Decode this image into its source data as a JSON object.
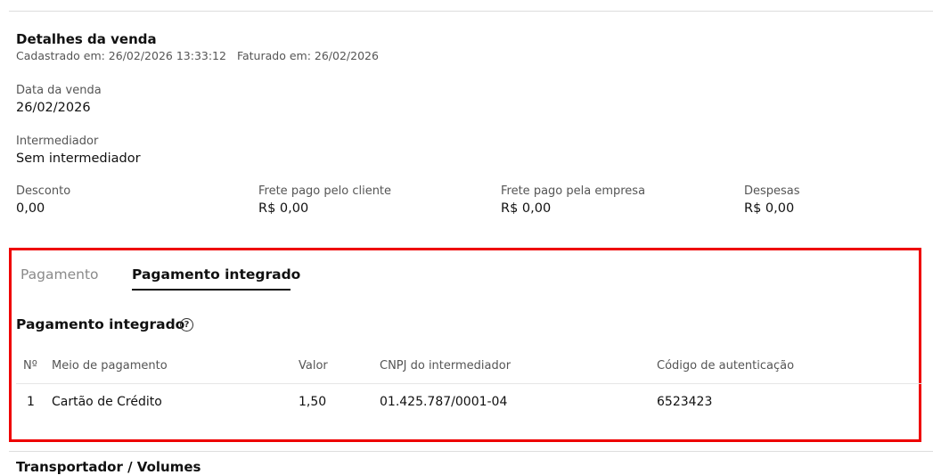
{
  "sale_details": {
    "title": "Detalhes da venda",
    "registered": "Cadastrado em: 26/02/2026 13:33:12",
    "invoiced": "Faturado em: 26/02/2026"
  },
  "fields": {
    "sale_date": {
      "label": "Data da venda",
      "value": "26/02/2026"
    },
    "intermediary": {
      "label": "Intermediador",
      "value": "Sem intermediador"
    },
    "discount": {
      "label": "Desconto",
      "value": "0,00"
    },
    "client_freight": {
      "label": "Frete pago pelo cliente",
      "value": "R$ 0,00"
    },
    "company_freight": {
      "label": "Frete pago pela empresa",
      "value": "R$ 0,00"
    },
    "expenses": {
      "label": "Despesas",
      "value": "R$ 0,00"
    }
  },
  "payment_tabs": {
    "tabs": [
      {
        "label": "Pagamento",
        "active": false
      },
      {
        "label": "Pagamento integrado",
        "active": true
      }
    ]
  },
  "integrated_payment": {
    "title": "Pagamento integrado",
    "help_icon": "question-circle",
    "help_glyph": "?",
    "columns": [
      "Nº",
      "Meio de pagamento",
      "Valor",
      "CNPJ do intermediador",
      "Código de autenticação"
    ],
    "rows": [
      {
        "number": "1",
        "method": "Cartão de Crédito",
        "value": "1,50",
        "cnpj": "01.425.787/0001-04",
        "auth_code": "6523423"
      }
    ]
  },
  "next_section": {
    "title": "Transportador / Volumes"
  },
  "colors": {
    "highlight": "#ee0000",
    "text": "#111111",
    "muted": "#555555"
  }
}
